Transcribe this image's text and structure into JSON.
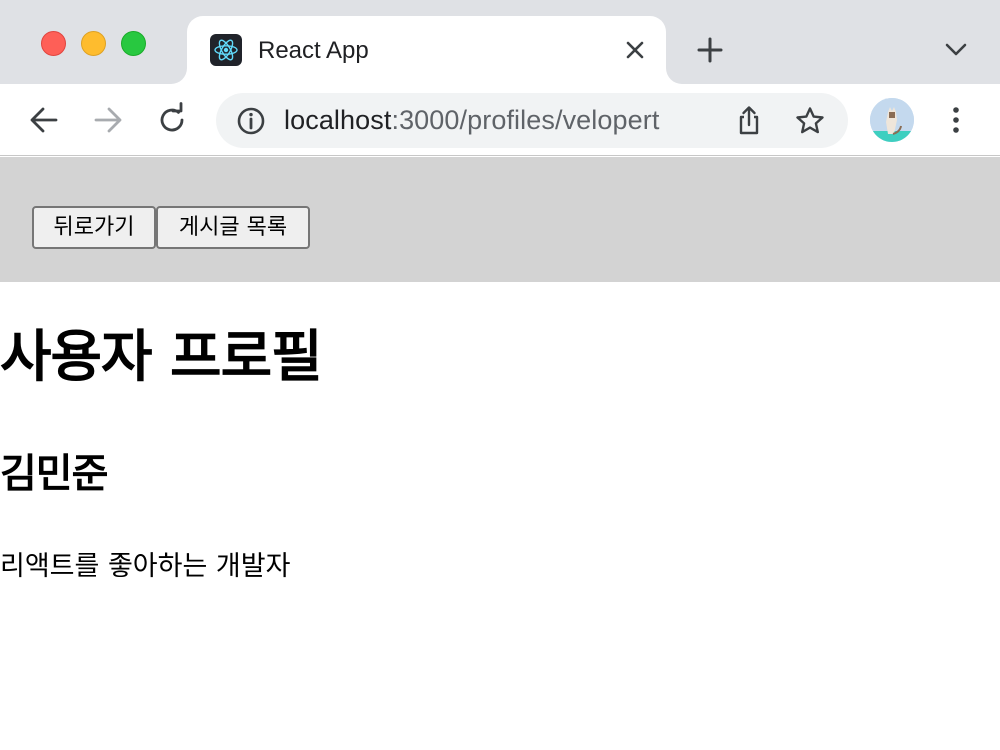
{
  "browser": {
    "tab": {
      "title": "React App",
      "favicon": "react-logo-icon"
    },
    "address_bar": {
      "host": "localhost",
      "path": ":3000/profiles/velopert"
    },
    "icons": {
      "close": "close-icon",
      "new_tab": "plus-icon",
      "tab_search": "chevron-down-icon",
      "back": "arrow-left-icon",
      "forward": "arrow-right-icon",
      "reload": "reload-icon",
      "site_info": "info-icon",
      "share": "share-icon",
      "bookmark": "star-icon",
      "menu": "kebab-menu-icon"
    },
    "colors": {
      "tabbar": "#dfe1e5",
      "omnibox": "#f1f3f4",
      "traffic_red": "#fe5f57",
      "traffic_yellow": "#febc2e",
      "traffic_green": "#28c840",
      "react_cyan": "#61dafb"
    }
  },
  "page": {
    "header": {
      "back_button": "뒤로가기",
      "articles_button": "게시글 목록",
      "background": "#d3d3d3"
    },
    "title": "사용자 프로필",
    "profile": {
      "name": "김민준",
      "description": "리액트를 좋아하는 개발자"
    }
  }
}
